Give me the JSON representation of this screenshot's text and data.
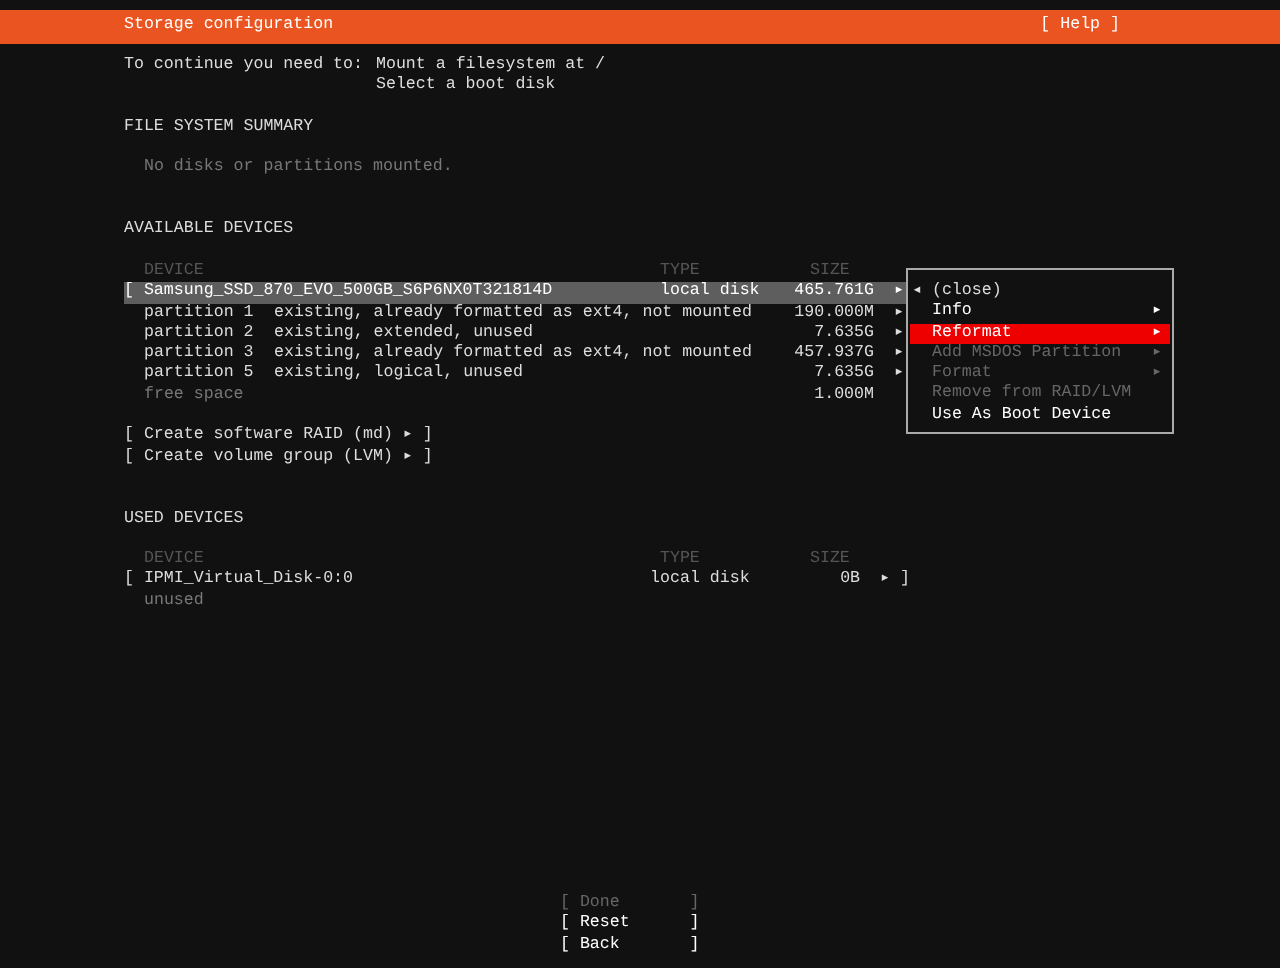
{
  "header": {
    "title": "Storage configuration",
    "help": "[ Help ]"
  },
  "prompt": {
    "label": "To continue you need to:",
    "requirements": [
      "Mount a filesystem at /",
      "Select a boot disk"
    ]
  },
  "file_system_summary": {
    "heading": "FILE SYSTEM SUMMARY",
    "empty_message": "No disks or partitions mounted."
  },
  "available_devices": {
    "heading": "AVAILABLE DEVICES",
    "columns": [
      "DEVICE",
      "TYPE",
      "SIZE"
    ],
    "rows": [
      {
        "kind": "disk",
        "name": "[ Samsung_SSD_870_EVO_500GB_S6P6NX0T321814D",
        "type": "local disk",
        "size": "465.761G",
        "trailer": "▸",
        "selected": true
      },
      {
        "kind": "partition",
        "name": "partition 1",
        "description": "existing, already formatted as ext4, not mounted",
        "size": "190.000M",
        "trailer": "▸",
        "selected": false
      },
      {
        "kind": "partition",
        "name": "partition 2",
        "description": "existing, extended, unused",
        "size": "7.635G",
        "trailer": "▸",
        "selected": false
      },
      {
        "kind": "partition",
        "name": "partition 3",
        "description": "existing, already formatted as ext4, not mounted",
        "size": "457.937G",
        "trailer": "▸",
        "selected": false
      },
      {
        "kind": "partition",
        "name": "partition 5",
        "description": "existing, logical, unused",
        "size": "7.635G",
        "trailer": "▸",
        "selected": false
      },
      {
        "kind": "free",
        "name": "free space",
        "size": "1.000M",
        "selected": false
      }
    ],
    "actions": [
      "[ Create software RAID (md) ▸ ]",
      "[ Create volume group (LVM) ▸ ]"
    ]
  },
  "action_menu": {
    "close_label": "◂ (close)",
    "items": [
      {
        "label": "Info",
        "submenu": "▸",
        "selected": false,
        "disabled": false
      },
      {
        "label": "Reformat",
        "submenu": "▸",
        "selected": true,
        "disabled": false
      },
      {
        "label": "Add MSDOS Partition",
        "submenu": "▸",
        "selected": false,
        "disabled": true
      },
      {
        "label": "Format",
        "submenu": "▸",
        "selected": false,
        "disabled": true
      },
      {
        "label": "Remove from RAID/LVM",
        "selected": false,
        "disabled": true
      },
      {
        "label": "Use As Boot Device",
        "selected": false,
        "disabled": false
      }
    ]
  },
  "used_devices": {
    "heading": "USED DEVICES",
    "columns": [
      "DEVICE",
      "TYPE",
      "SIZE"
    ],
    "rows": [
      {
        "kind": "disk",
        "name": "[ IPMI_Virtual_Disk-0:0",
        "type": "local disk",
        "size": "0B",
        "trailer": "▸ ]",
        "note": "unused",
        "selected": false
      }
    ]
  },
  "buttons": [
    {
      "label": "[ Done       ]",
      "disabled": true
    },
    {
      "label": "[ Reset      ]",
      "disabled": false
    },
    {
      "label": "[ Back       ]",
      "disabled": false
    }
  ]
}
